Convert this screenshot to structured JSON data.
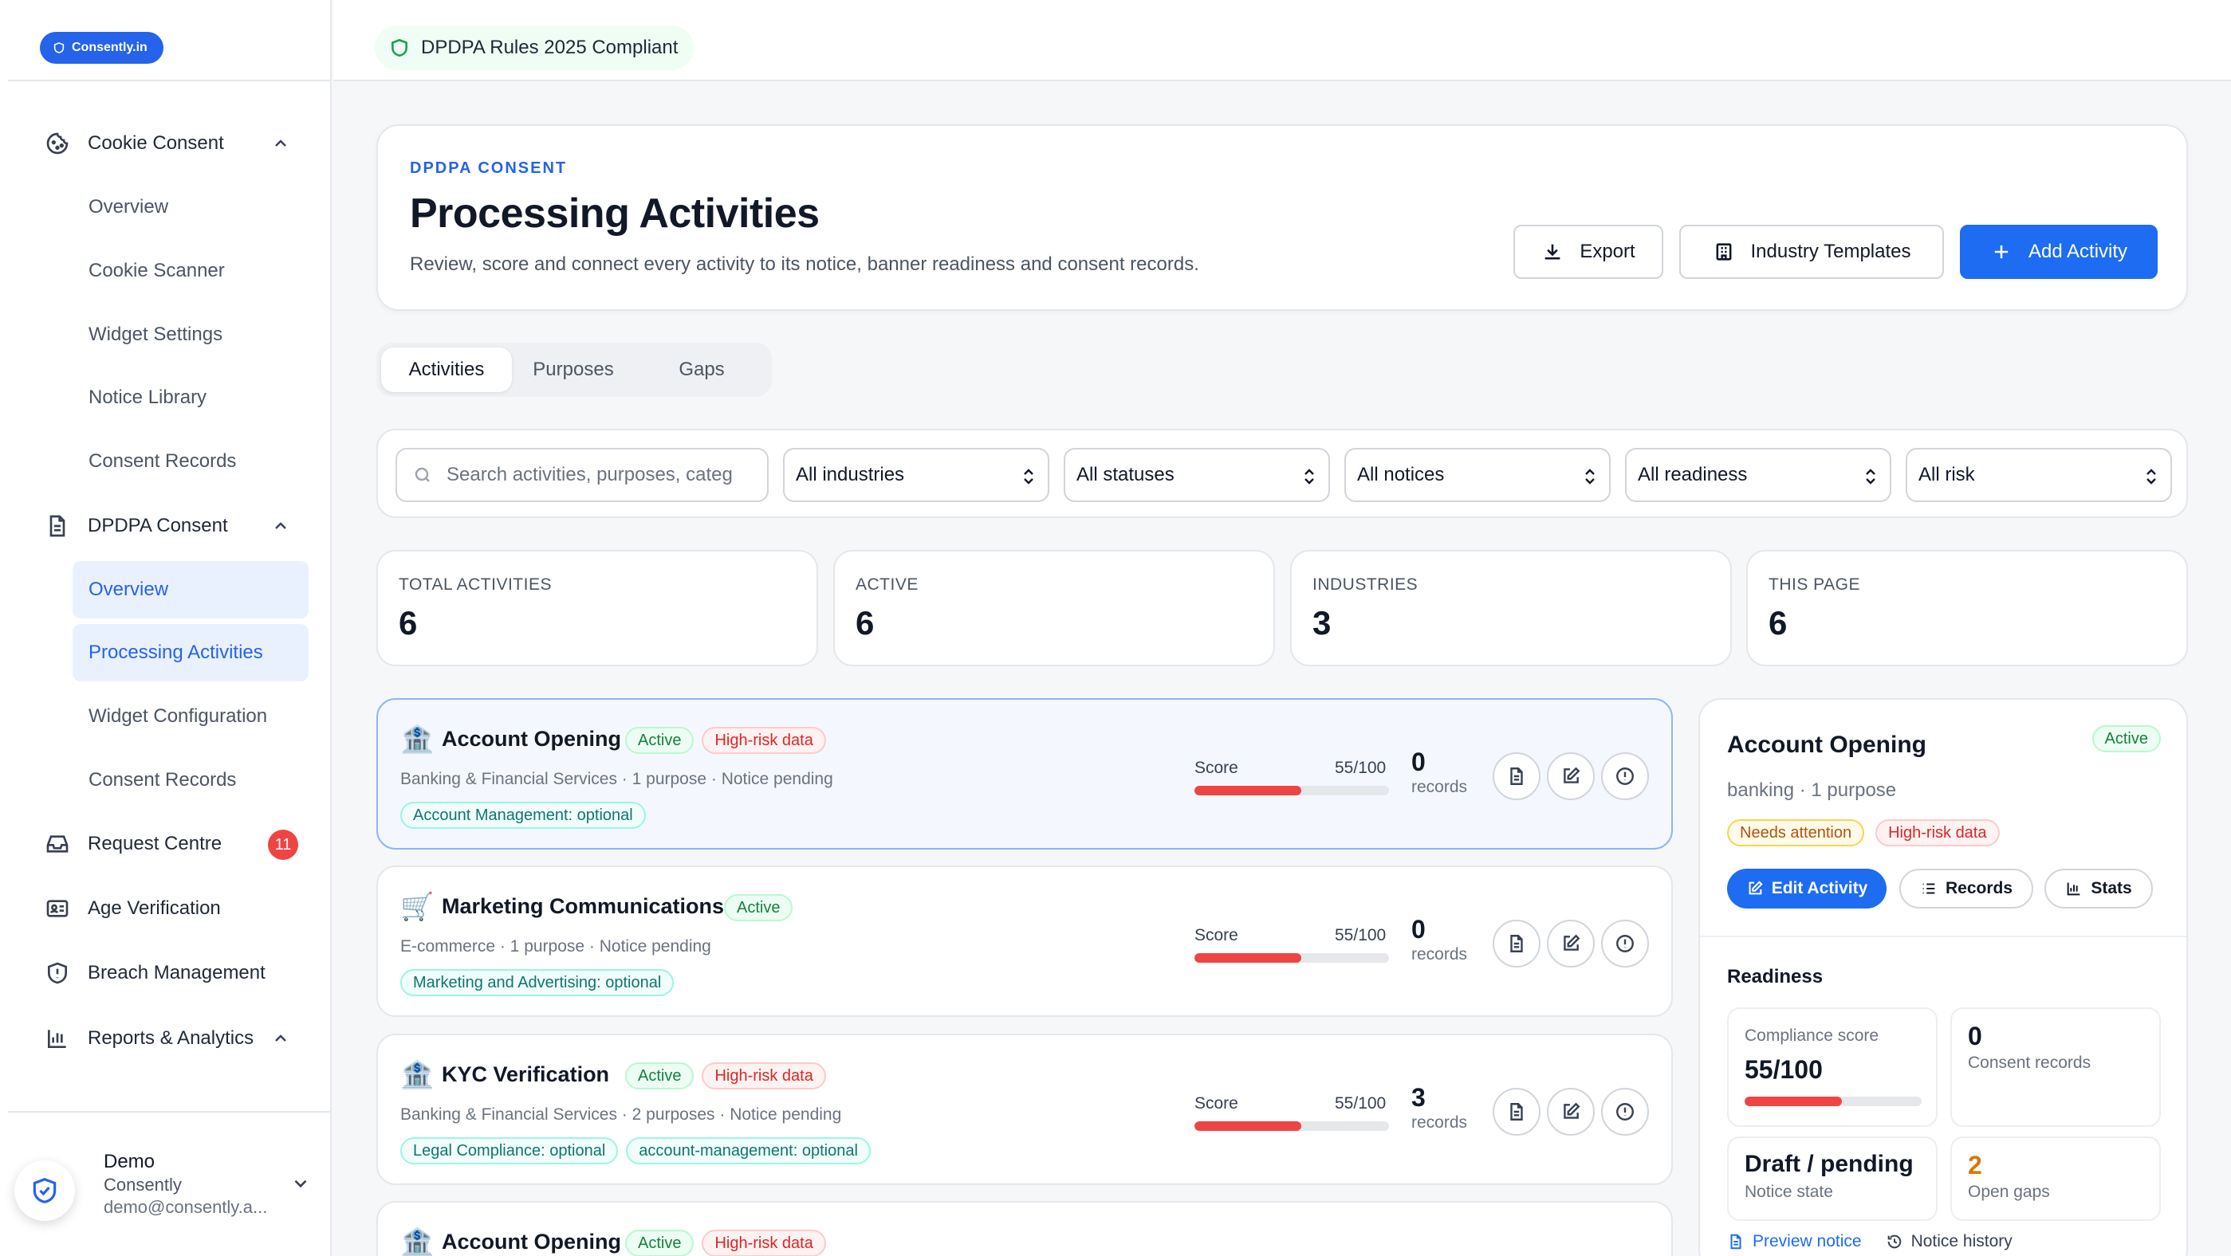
{
  "brand": {
    "label": "Consently.in"
  },
  "sidebar": {
    "cookie_consent": {
      "label": "Cookie Consent",
      "children": [
        "Overview",
        "Cookie Scanner",
        "Widget Settings",
        "Notice Library",
        "Consent Records"
      ]
    },
    "dpdpa_consent": {
      "label": "DPDPA Consent",
      "children": [
        "Overview",
        "Processing Activities",
        "Widget Configuration",
        "Consent Records"
      ]
    },
    "request_centre": {
      "label": "Request Centre",
      "badge": "11"
    },
    "age_verification": {
      "label": "Age Verification"
    },
    "breach_management": {
      "label": "Breach Management"
    },
    "reports_analytics": {
      "label": "Reports & Analytics"
    },
    "user": {
      "name": "Demo",
      "org": "Consently",
      "email": "demo@consently.a..."
    }
  },
  "topbar": {
    "compliance_label": "DPDPA Rules 2025 Compliant"
  },
  "header": {
    "eyebrow": "DPDPA CONSENT",
    "title": "Processing Activities",
    "subtitle": "Review, score and connect every activity to its notice, banner readiness and consent records.",
    "export_label": "Export",
    "templates_label": "Industry Templates",
    "add_label": "Add Activity"
  },
  "tabs": [
    "Activities",
    "Purposes",
    "Gaps"
  ],
  "filters": {
    "search_placeholder": "Search activities, purposes, categ",
    "industry": "All industries",
    "status": "All statuses",
    "notice": "All notices",
    "readiness": "All readiness",
    "risk": "All risk"
  },
  "stats": [
    {
      "label": "TOTAL ACTIVITIES",
      "value": "6"
    },
    {
      "label": "ACTIVE",
      "value": "6"
    },
    {
      "label": "INDUSTRIES",
      "value": "3"
    },
    {
      "label": "THIS PAGE",
      "value": "6"
    }
  ],
  "activities": [
    {
      "emoji": "🏦",
      "name": "Account Opening",
      "status": "Active",
      "risk": "High-risk data",
      "meta": "Banking & Financial Services · 1 purpose · Notice pending",
      "tags": [
        "Account Management: optional"
      ],
      "score_label": "Score",
      "score": "55/100",
      "score_fraction": 0.55,
      "records": "0",
      "records_label": "records"
    },
    {
      "emoji": "🛒",
      "name": "Marketing Communications",
      "status": "Active",
      "risk": "",
      "meta": "E-commerce · 1 purpose · Notice pending",
      "tags": [
        "Marketing and Advertising: optional"
      ],
      "score_label": "Score",
      "score": "55/100",
      "score_fraction": 0.55,
      "records": "0",
      "records_label": "records"
    },
    {
      "emoji": "🏦",
      "name": "KYC Verification",
      "status": "Active",
      "risk": "High-risk data",
      "meta": "Banking & Financial Services · 2 purposes · Notice pending",
      "tags": [
        "Legal Compliance: optional",
        "account-management: optional"
      ],
      "score_label": "Score",
      "score": "55/100",
      "score_fraction": 0.55,
      "records": "3",
      "records_label": "records"
    },
    {
      "emoji": "🏦",
      "name": "Account Opening",
      "status": "Active",
      "risk": "High-risk data",
      "meta": "",
      "tags": [],
      "score_label": "",
      "score": "",
      "score_fraction": 0,
      "records": "",
      "records_label": ""
    }
  ],
  "detail": {
    "title": "Account Opening",
    "status": "Active",
    "meta": "banking · 1 purpose",
    "badges": {
      "attention": "Needs attention",
      "risk": "High-risk data"
    },
    "edit_label": "Edit Activity",
    "records_label": "Records",
    "stats_label": "Stats",
    "readiness_title": "Readiness",
    "compliance_label": "Compliance score",
    "compliance_value": "55/100",
    "compliance_fraction": 0.55,
    "consent_records_value": "0",
    "consent_records_label": "Consent records",
    "notice_state_value": "Draft / pending",
    "notice_state_label": "Notice state",
    "open_gaps_value": "2",
    "open_gaps_label": "Open gaps",
    "preview_notice_label": "Preview notice",
    "notice_history_label": "Notice history"
  },
  "colors": {
    "accent": "#1d6cf2",
    "success": "#15803d",
    "danger": "#ef4444",
    "warning": "#d97706"
  }
}
